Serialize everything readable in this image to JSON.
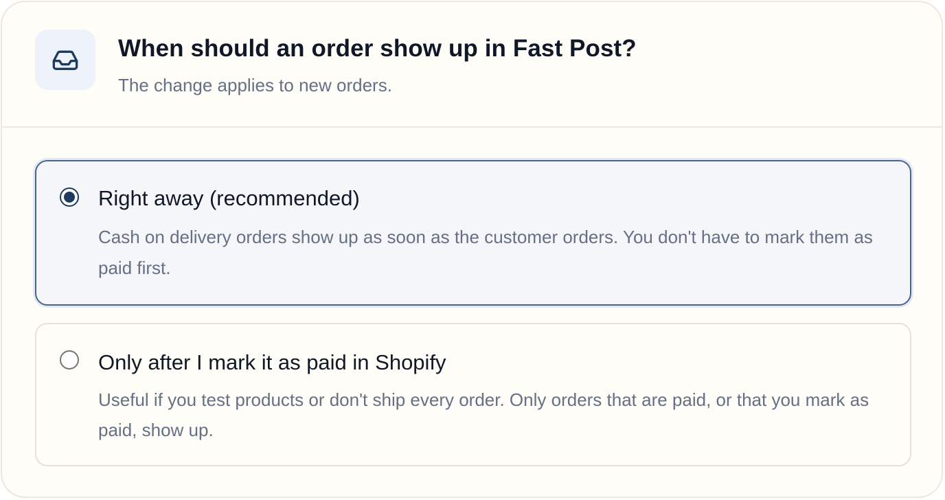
{
  "header": {
    "icon": "inbox-icon",
    "title": "When should an order show up in Fast Post?",
    "subtitle": "The change applies to new orders."
  },
  "options": [
    {
      "title": "Right away (recommended)",
      "description": "Cash on delivery orders show up as soon as the customer orders. You don't have to mark them as paid first.",
      "selected": true
    },
    {
      "title": "Only after I mark it as paid in Shopify",
      "description": "Useful if you test products or don't ship every order. Only orders that are paid, or that you mark as paid, show up.",
      "selected": false
    }
  ],
  "colors": {
    "accent": "#1f3a5f",
    "text_primary": "#101828",
    "text_secondary": "#667085",
    "card_background": "#fffdf8",
    "selected_background": "#f4f6fa"
  }
}
